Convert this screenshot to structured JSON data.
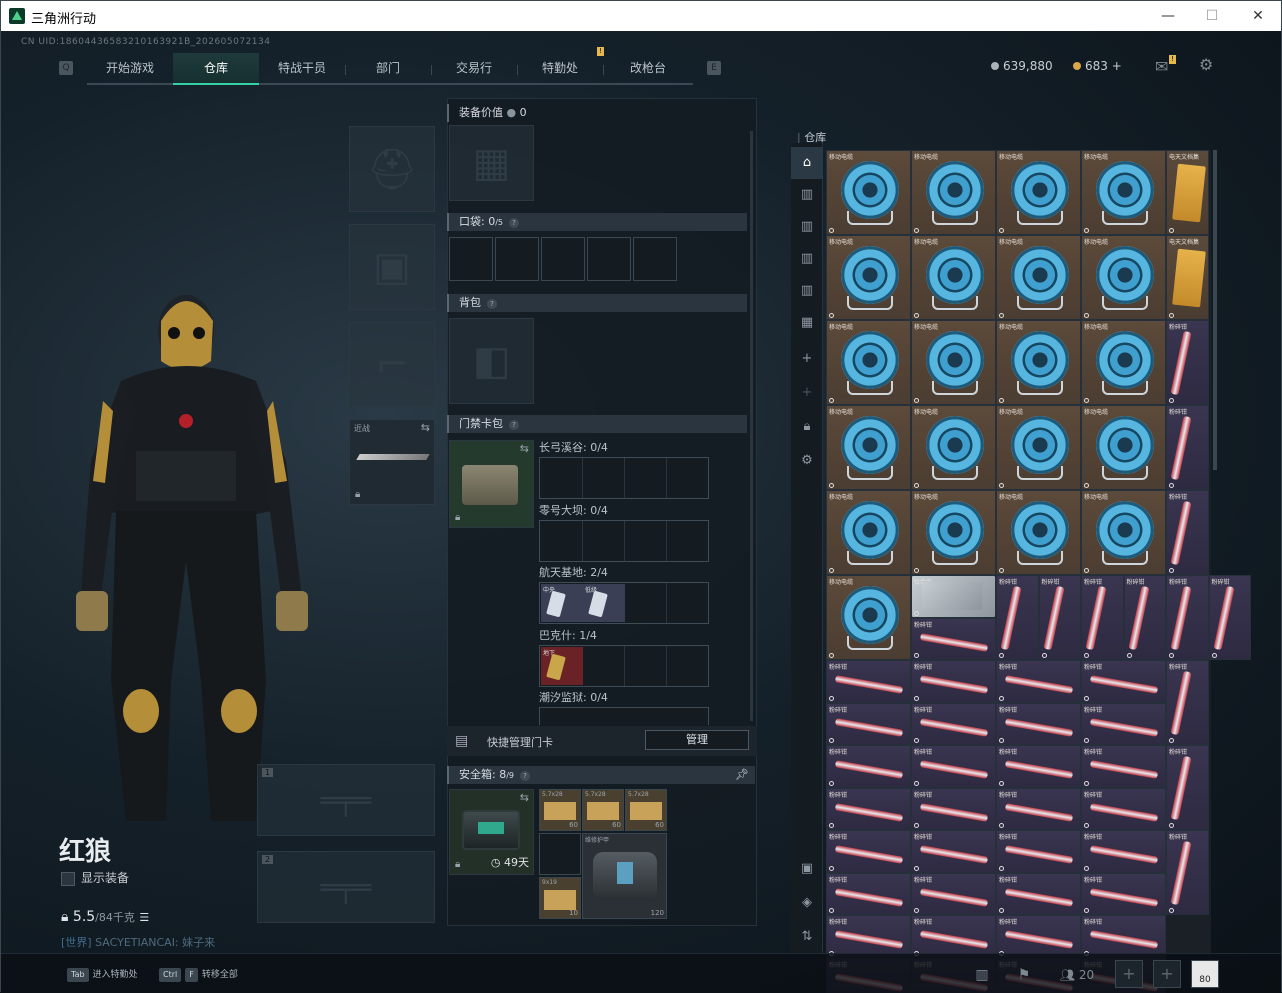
{
  "window": {
    "title": "三角洲行动",
    "min": "—",
    "max": "☐",
    "close": "✕"
  },
  "uid": "CN UID:18604436583210163921B_202605072134",
  "nav": {
    "left_key": "Q",
    "right_key": "E",
    "tabs": [
      {
        "label": "开始游戏"
      },
      {
        "label": "仓库"
      },
      {
        "label": "特战干员"
      },
      {
        "label": "部门"
      },
      {
        "label": "交易行"
      },
      {
        "label": "特勤处"
      },
      {
        "label": "改枪台"
      }
    ],
    "notice_badge": "!"
  },
  "currency": {
    "a": "639,880",
    "b": "683",
    "b_plus": "+"
  },
  "character": {
    "name": "红狼",
    "show_equipment": "显示装备",
    "weight": "5.5",
    "weight_max": "/84千克",
    "chat_world": "[世界]",
    "chat_text": "SACYETIANCAI: 妹子来"
  },
  "equip": {
    "melee_label": "近战"
  },
  "middle": {
    "value_label": "装备价值",
    "value": "0",
    "pockets_label": "口袋: ",
    "pockets_count": "0",
    "pockets_max": "/5",
    "backpack_label": "背包",
    "keycard_label": "门禁卡包",
    "keycards": [
      {
        "name": "长弓溪谷: 0/4"
      },
      {
        "name": "零号大坝: 0/4"
      },
      {
        "name": "航天基地: 2/4"
      },
      {
        "name": "巴克什: 1/4"
      },
      {
        "name": "潮汐监狱: 0/4"
      }
    ],
    "card_labels": [
      "中央",
      "低级",
      "地下"
    ],
    "quick_manage": "快捷管理门卡",
    "manage_btn": "管理",
    "safebox_label": "安全箱: ",
    "safebox_count": "8",
    "safebox_max": "/9",
    "safebox_days": "49天",
    "safebox_items": [
      {
        "name": "5.7x28",
        "count": "60"
      },
      {
        "name": "5.7x28",
        "count": "60"
      },
      {
        "name": "5.7x28",
        "count": "60"
      },
      {
        "name": "维修护甲",
        "count": "120"
      },
      {
        "name": "9x19",
        "count": "10"
      }
    ]
  },
  "warehouse": {
    "title": "仓库",
    "item_names": {
      "reel": "移动电缆",
      "doc": "电天文档集",
      "pipe": "粉碎钳",
      "plate": "钛合金"
    }
  },
  "bottom": {
    "tab_key": "Tab",
    "tab_label": "进入特勤处",
    "ctrl_key": "Ctrl",
    "f_key": "F",
    "f_label": "转移全部",
    "friends": "20",
    "avatar_count": "80"
  }
}
